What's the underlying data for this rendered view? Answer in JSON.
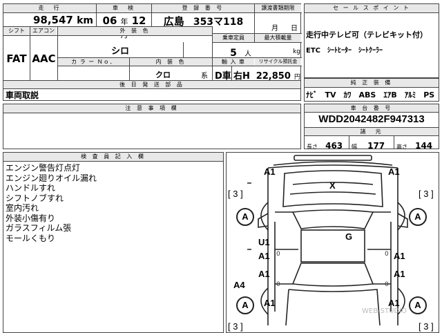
{
  "top": {
    "mileage_label": "走　行",
    "mileage": "98,547",
    "mileage_unit": "km",
    "inspection_label": "車　検",
    "inspection_year": "06",
    "inspection_year_unit": "年",
    "inspection_month": "12",
    "inspection_month_unit": "月",
    "reg_label": "登 録 番 号",
    "reg_area": "広島",
    "reg_num": "353マ118",
    "transfer_label": "譲渡書類期限",
    "transfer_m": "月",
    "transfer_d": "日",
    "shift_label": "シフト",
    "shift": "FAT",
    "aircon_label": "エアコン",
    "aircon": "AAC",
    "ext_color_label": "外 装 色",
    "ext_color": "シロ",
    "capacity_label": "乗車定員",
    "capacity": "5",
    "capacity_unit": "人",
    "load_label": "最大積載量",
    "load_unit": "kg",
    "color_no_label": "カ ラ ー Ｎｏ．",
    "int_color_label": "内 装 色",
    "int_color": "クロ",
    "int_color_unit": "系",
    "import_label": "輸 入 車",
    "import_d": "D車",
    "import_h": "右H",
    "recycle_label": "リサイクル預託金",
    "recycle": "22,850",
    "recycle_unit": "円"
  },
  "sales": {
    "label": "セ ー ル ス ポ イ ン ト",
    "line1": "走行中テレビ可（テレビキット付）",
    "line2": "ETC　ｼｰﾄﾋｰﾀｰ　ｼｰﾄｸｰﾗｰ"
  },
  "equip": {
    "label": "純 正 装 備",
    "items": "ﾅﾋﾞ　TV　ｶﾜ　ABS　ｴｱB　ｱﾙﾐ　PS　PW"
  },
  "later": {
    "label": "後 日 発 送 部 品"
  },
  "removed": {
    "label": "車両取説"
  },
  "notes": {
    "label": "注 意 事 項 欄"
  },
  "chassis": {
    "label": "車 台 番 号",
    "vin": "WDD2042482F947313",
    "dims_label": "諸　元",
    "len_label": "長さ",
    "len": "463",
    "wid_label": "幅",
    "wid": "177",
    "hei_label": "高さ",
    "hei": "144"
  },
  "inspector": {
    "label": "検 査 員 記 入 欄",
    "items": [
      "エンジン警告灯点灯",
      "エンジン廻りオイル漏れ",
      "ハンドルすれ",
      "シフトノブすれ",
      "室内汚れ",
      "外装小傷有り",
      "ガラスフィルム張",
      "モールくもり"
    ]
  },
  "diagram": {
    "a1_tl": "A1",
    "a1_tr": "A1",
    "x": "X",
    "br3_l": "[ 3 ]",
    "br3_r": "[ 3 ]",
    "a_l1": "A",
    "a_r1": "A",
    "u1": "U1",
    "g": "G",
    "a1_ml": "A1",
    "a1_mr": "A1",
    "a1_ll": "A1",
    "a1_lr": "A1",
    "a4": "A4",
    "a_l2": "A",
    "a_r2": "A",
    "a1_bl": "A1",
    "a1_br": "A1",
    "br3_bl": "[ 3 ]",
    "br3_br": "[ 3 ]",
    "zero": "0",
    "watermark": "WEB-STUDIO"
  }
}
